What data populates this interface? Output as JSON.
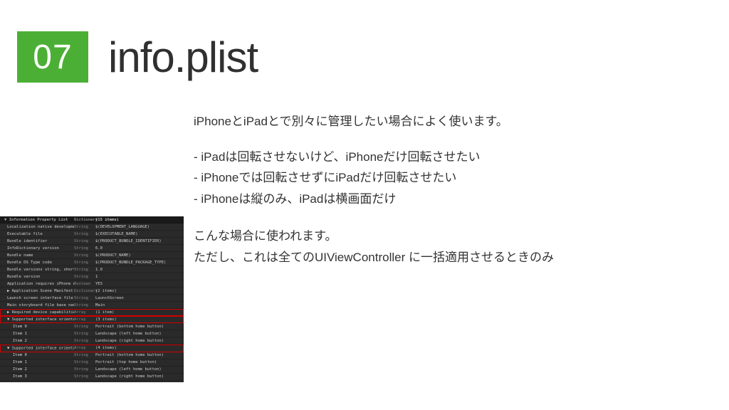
{
  "header": {
    "number": "07",
    "title": "info.plist"
  },
  "content": {
    "intro": "iPhoneとiPadとで別々に管理したい場合によく使います。",
    "bullet1": "- iPadは回転させないけど、iPhoneだけ回転させたい",
    "bullet2": "- iPhoneでは回転させずにiPadだけ回転させたい",
    "bullet3": "- iPhoneは縦のみ、iPadは横画面だけ",
    "note1": "こんな場合に使われます。",
    "note2": "ただし、これは全てのUIViewController に一括適用させるときのみ"
  },
  "plist": {
    "headers": {
      "key": "▼ Information Property List",
      "type": "Dictionary",
      "value": "(15 items)"
    },
    "rows": [
      {
        "key": "Localization native development region",
        "type": "String",
        "value": "$(DEVELOPMENT_LANGUAGE)",
        "indent": 1
      },
      {
        "key": "Executable file",
        "type": "String",
        "value": "$(EXECUTABLE_NAME)",
        "indent": 1
      },
      {
        "key": "Bundle identifier",
        "type": "String",
        "value": "$(PRODUCT_BUNDLE_IDENTIFIER)",
        "indent": 1
      },
      {
        "key": "InfoDictionary version",
        "type": "String",
        "value": "6.0",
        "indent": 1
      },
      {
        "key": "Bundle name",
        "type": "String",
        "value": "$(PRODUCT_NAME)",
        "indent": 1
      },
      {
        "key": "Bundle OS Type code",
        "type": "String",
        "value": "$(PRODUCT_BUNDLE_PACKAGE_TYPE)",
        "indent": 1
      },
      {
        "key": "Bundle versions string, short",
        "type": "String",
        "value": "1.0",
        "indent": 1
      },
      {
        "key": "Bundle version",
        "type": "String",
        "value": "1",
        "indent": 1
      },
      {
        "key": "Application requires iPhone environment",
        "type": "Boolean",
        "value": "YES",
        "indent": 1
      },
      {
        "key": "▶ Application Scene Manifest",
        "type": "Dictionary",
        "value": "(2 items)",
        "indent": 1
      },
      {
        "key": "Launch screen interface file base name",
        "type": "String",
        "value": "LaunchScreen",
        "indent": 1
      },
      {
        "key": "Main storyboard file base name",
        "type": "String",
        "value": "Main",
        "indent": 1
      },
      {
        "key": "▶ Required device capabilities",
        "type": "Array",
        "value": "(1 item)",
        "indent": 1,
        "highlight": "red-top"
      },
      {
        "key": "▼ Supported interface orientations",
        "type": "Array",
        "value": "(3 items)",
        "indent": 1,
        "highlight": "red"
      },
      {
        "key": "Item 0",
        "type": "String",
        "value": "Portrait (bottom home button)",
        "indent": 2
      },
      {
        "key": "Item 1",
        "type": "String",
        "value": "Landscape (left home button)",
        "indent": 2
      },
      {
        "key": "Item 2",
        "type": "String",
        "value": "Landscape (right home button)",
        "indent": 2
      },
      {
        "key": "▼ Supported interface orientations (iPad)",
        "type": "Array",
        "value": "(4 items)",
        "indent": 1,
        "highlight": "red",
        "icons": true
      },
      {
        "key": "Item 0",
        "type": "String",
        "value": "Portrait (bottom home button)",
        "indent": 2
      },
      {
        "key": "Item 1",
        "type": "String",
        "value": "Portrait (top home button)",
        "indent": 2
      },
      {
        "key": "Item 2",
        "type": "String",
        "value": "Landscape (left home button)",
        "indent": 2
      },
      {
        "key": "Item 3",
        "type": "String",
        "value": "Landscape (right home button)",
        "indent": 2
      }
    ]
  }
}
